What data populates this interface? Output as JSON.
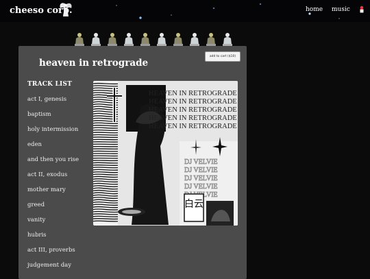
{
  "header": {
    "logo": "cheeso corp.",
    "nav": {
      "home": "home",
      "music": "music"
    }
  },
  "album": {
    "title": "heaven in retrograde",
    "cart_label": "add to cart ($10)",
    "cover_title_line": "HEAVEN IN RETROGRADE",
    "cover_artist_line": "DJ VELVIE",
    "cover_kanji": "白云"
  },
  "tracklist": {
    "heading": "TRACK LIST",
    "items": [
      "act I, genesis",
      "baptism",
      "holy intermission",
      "eden",
      "and then you rise",
      "act II, exodus",
      "mother mary",
      "greed",
      "vanity",
      "hubris",
      "act III, proverbs",
      "judgement day"
    ]
  },
  "icons": {
    "angel": "angel-icon",
    "cart": "cart-icon",
    "figure": "praying-figure-icon"
  }
}
